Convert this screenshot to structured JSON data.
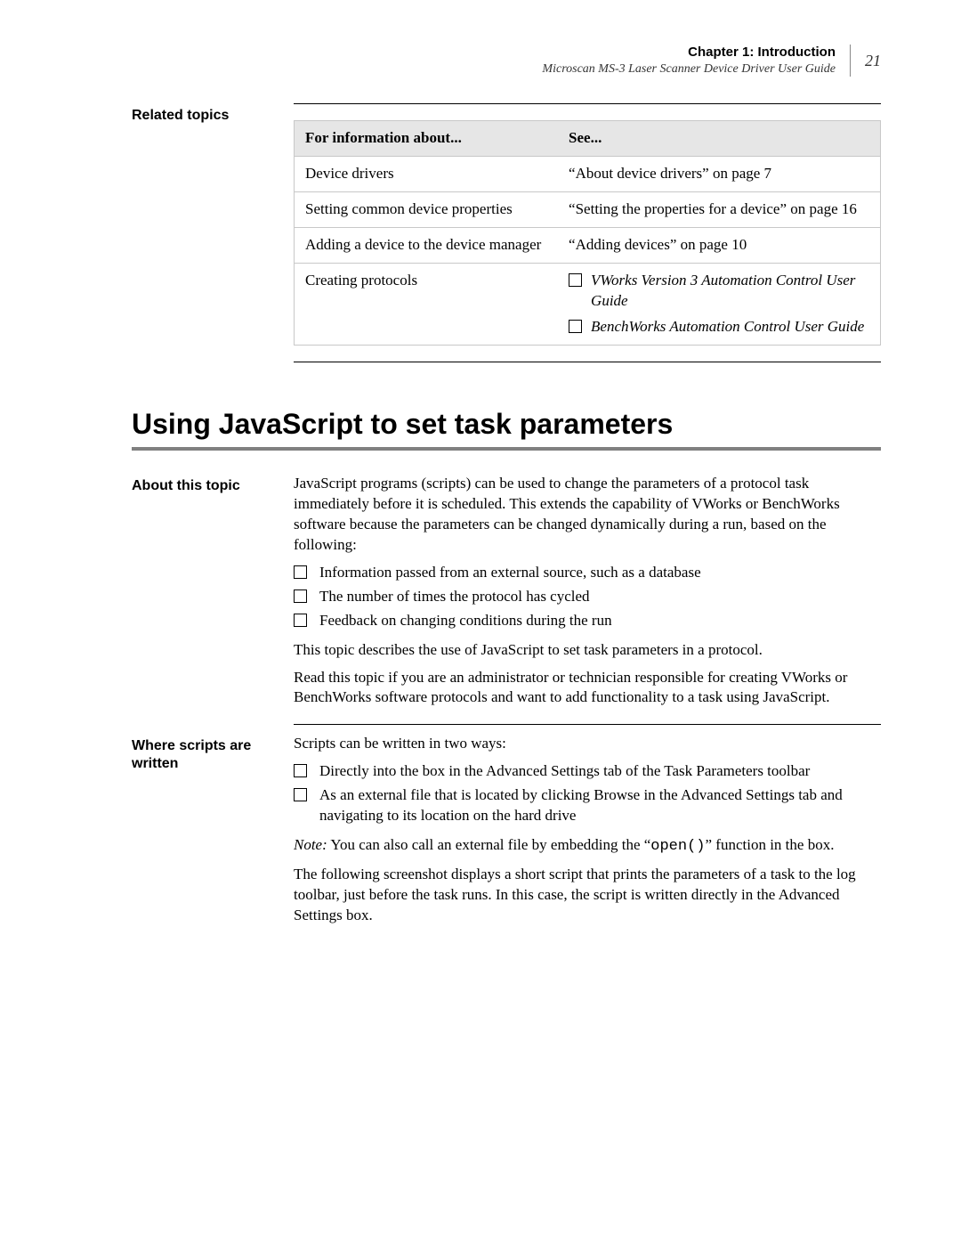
{
  "header": {
    "chapter": "Chapter 1: Introduction",
    "doc_title": "Microscan MS-3 Laser Scanner Device Driver User Guide",
    "page_number": "21"
  },
  "related_topics": {
    "heading": "Related topics",
    "table": {
      "col1": "For information about...",
      "col2": "See...",
      "rows": [
        {
          "about": "Device drivers",
          "see": "“About device drivers” on page 7"
        },
        {
          "about": "Setting common device properties",
          "see": "“Setting the properties for a device” on page 16"
        },
        {
          "about": "Adding a device to the device manager",
          "see": "“Adding devices” on page 10"
        },
        {
          "about": "Creating protocols",
          "see_list": [
            "VWorks Version 3 Automation Control User Guide",
            "BenchWorks Automation Control User Guide"
          ]
        }
      ]
    }
  },
  "main_heading": "Using JavaScript to set task parameters",
  "about_topic": {
    "heading": "About this topic",
    "p1": "JavaScript programs (scripts) can be used to change the parameters of a protocol task immediately before it is scheduled. This extends the capability of VWorks or BenchWorks software because the parameters can be changed dynamically during a run, based on the following:",
    "bullets": [
      "Information passed from an external source, such as a database",
      "The number of times the protocol has cycled",
      "Feedback on changing conditions during the run"
    ],
    "p2": "This topic describes the use of JavaScript to set task parameters in a protocol.",
    "p3": "Read this topic if you are an administrator or technician responsible for creating VWorks or BenchWorks software protocols and want to add functionality to a task using JavaScript."
  },
  "where_written": {
    "heading": "Where scripts are written",
    "p1": "Scripts can be written in two ways:",
    "bullets": [
      "Directly into the box in the Advanced Settings tab of the Task Parameters toolbar",
      "As an external file that is located by clicking Browse in the Advanced Settings tab and navigating to its location on the hard drive"
    ],
    "note_label": "Note:",
    "note_pre": " You can also call an external file by embedding the “",
    "note_code": "open()",
    "note_post": "” function in the box.",
    "p2": "The following screenshot displays a short script that prints the parameters of a task to the log toolbar, just before the task runs. In this case, the script is written directly in the Advanced Settings box."
  }
}
